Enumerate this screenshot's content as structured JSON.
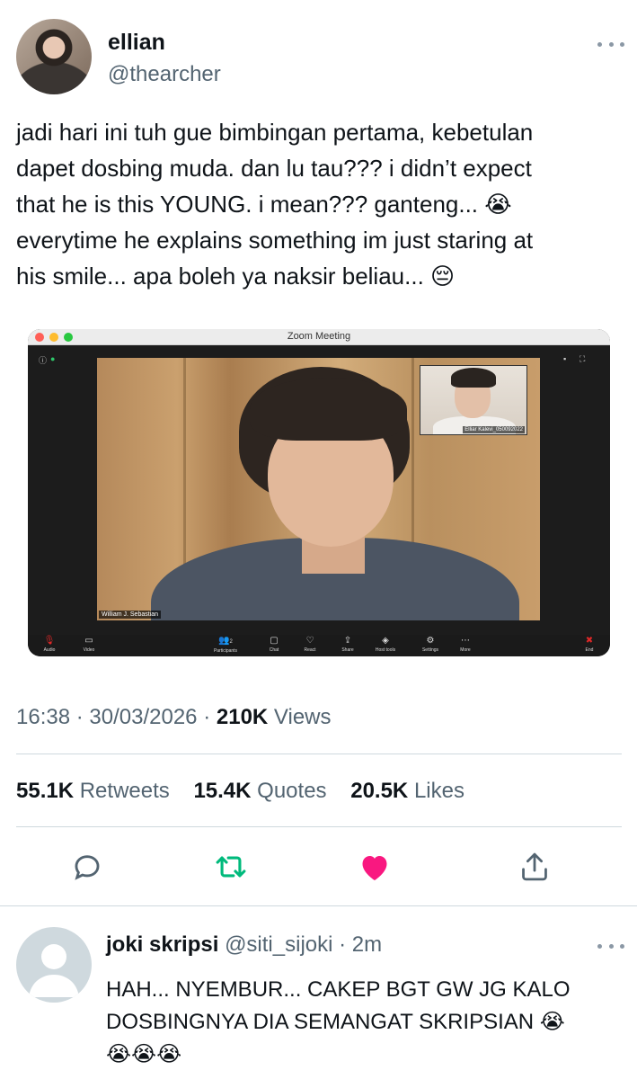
{
  "tweet": {
    "author": {
      "display_name": "ellian",
      "handle": "@thearcher"
    },
    "text": "jadi hari ini tuh gue bimbingan pertama, kebetulan\ndapet dosbing muda. dan lu tau??? i didn’t expect\nthat he is this YOUNG. i mean??? ganteng... 😭\neverytime he explains something im just staring at\nhis smile... apa boleh ya naksir beliau... 😔",
    "media": {
      "window_title": "Zoom Meeting",
      "main_participant_name": "William J. Sebastian",
      "self_participant_name": "Elliar Kalevi_050092022",
      "participants_count": "2",
      "toolbar": [
        {
          "label": "Audio",
          "icon": "mic-muted-icon"
        },
        {
          "label": "Video",
          "icon": "video-icon"
        },
        {
          "label": "Participants",
          "icon": "participants-icon"
        },
        {
          "label": "Chat",
          "icon": "chat-icon"
        },
        {
          "label": "React",
          "icon": "heart-icon"
        },
        {
          "label": "Share",
          "icon": "share-screen-icon"
        },
        {
          "label": "Host tools",
          "icon": "shield-icon"
        },
        {
          "label": "Settings",
          "icon": "gear-icon"
        },
        {
          "label": "More",
          "icon": "more-icon"
        },
        {
          "label": "End",
          "icon": "end-icon"
        }
      ],
      "colors": {
        "close": "#ff5f57",
        "minimize": "#febc2e",
        "zoom": "#28c840",
        "end": "#e02828"
      }
    },
    "time": "16:38",
    "date": "30/03/2026",
    "views_count": "210K",
    "views_label": "Views",
    "stats": {
      "retweets_count": "55.1K",
      "retweets_label": "Retweets",
      "quotes_count": "15.4K",
      "quotes_label": "Quotes",
      "likes_count": "20.5K",
      "likes_label": "Likes"
    },
    "actions": {
      "reply_icon": "reply-icon",
      "retweet_icon": "retweet-icon",
      "like_icon": "heart-icon",
      "share_icon": "share-icon",
      "retweet_color": "#00ba7c",
      "like_color": "#f91880",
      "liked": true
    }
  },
  "reply": {
    "display_name": "joki skripsi",
    "handle": "@siti_sijoki",
    "separator": "·",
    "time": "2m",
    "text": "HAH... NYEMBUR... CAKEP BGT GW JG KALO\nDOSBINGNYA DIA SEMANGAT SKRIPSIAN 😭\n😭😭😭"
  },
  "separator": "·"
}
